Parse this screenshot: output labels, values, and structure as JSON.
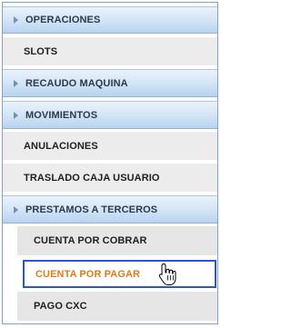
{
  "menu": {
    "items": [
      {
        "label": "OPERACIONES"
      },
      {
        "label": "SLOTS"
      },
      {
        "label": "RECAUDO MAQUINA"
      },
      {
        "label": "MOVIMIENTOS"
      },
      {
        "label": "ANULACIONES"
      },
      {
        "label": "TRASLADO CAJA USUARIO"
      },
      {
        "label": "PRESTAMOS A TERCEROS"
      },
      {
        "label": "CUENTA POR COBRAR"
      },
      {
        "label": "CUENTA POR PAGAR"
      },
      {
        "label": "PAGO CXC"
      }
    ]
  },
  "colors": {
    "accent": "#2f56c8",
    "selected_text": "#e07b1a",
    "parent_gradient_top": "#eaf2fb",
    "parent_gradient_bottom": "#b8d3ef"
  },
  "icons": {
    "expand": "triangle-right-icon",
    "pointer": "hand-pointer-icon"
  }
}
